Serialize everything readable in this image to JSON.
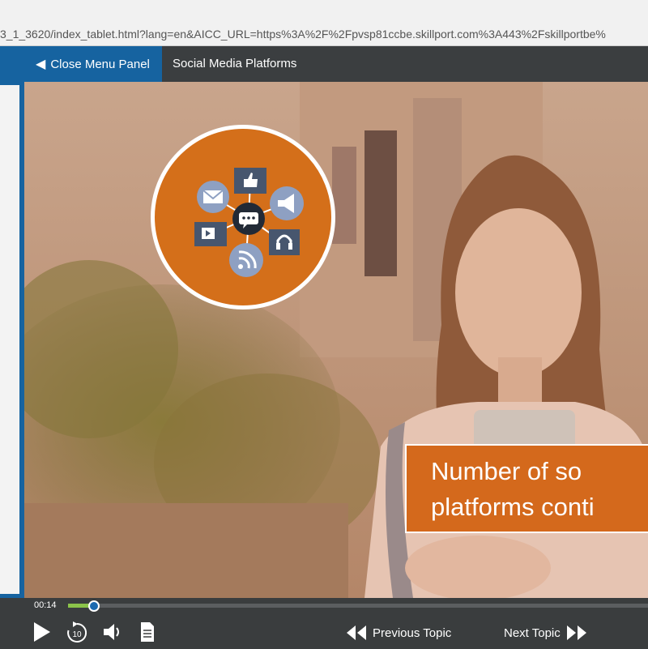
{
  "browser": {
    "url": "3_1_3620/index_tablet.html?lang=en&AICC_URL=https%3A%2F%2Fpvsp81ccbe.skillport.com%3A443%2Fskillportbe%"
  },
  "header": {
    "close_menu_label": "Close Menu Panel",
    "title": "Social Media Platforms"
  },
  "slide": {
    "caption_line1": "Number of so",
    "caption_line2": "platforms conti"
  },
  "player": {
    "time": "00:14",
    "progress": 0.045,
    "replay_label": "10",
    "prev_label": "Previous Topic",
    "next_label": "Next Topic"
  },
  "colors": {
    "accent_blue": "#1663a0",
    "orange": "#d46f1a",
    "progress_green": "#8bc34a"
  },
  "icons": [
    "chevron-left-icon",
    "chat-icon",
    "mail-icon",
    "thumbs-up-icon",
    "megaphone-icon",
    "video-icon",
    "headphones-icon",
    "rss-icon",
    "play-icon",
    "replay-10-icon",
    "volume-icon",
    "transcript-icon",
    "double-chevron-left-icon",
    "double-chevron-right-icon"
  ]
}
